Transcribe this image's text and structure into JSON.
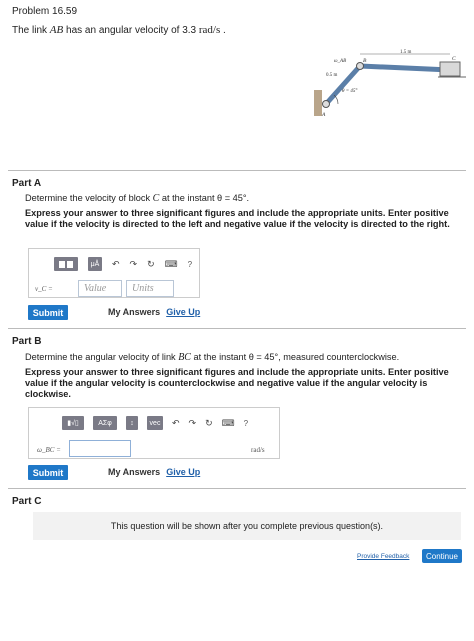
{
  "problem_title": "Problem 16.59",
  "intro": {
    "prefix": "The link ",
    "link": "AB",
    "middle": " has an angular velocity of 3.3 ",
    "unit": "rad/s",
    "suffix": " ."
  },
  "figure": {
    "dim_bc": "1.5 m",
    "dim_ab": "0.5 m",
    "omega_label": "ω_AB",
    "angle_label": "θ = 45°",
    "point_a": "A",
    "point_b": "B",
    "point_c": "C"
  },
  "partA": {
    "heading": "Part A",
    "question_prefix": "Determine the velocity of block ",
    "question_var": "C",
    "question_suffix": " at the instant θ = 45°.",
    "instructions": "Express your answer to three significant figures and include the appropriate units. Enter positive value if the velocity is directed to the left and negative value if the velocity is directed to the right.",
    "toolbar_help": "?",
    "input_label": "v_C =",
    "value_placeholder": "Value",
    "units_placeholder": "Units",
    "submit_label": "Submit",
    "my_answers": "My Answers",
    "give_up": "Give Up"
  },
  "partB": {
    "heading": "Part B",
    "question_prefix": "Determine the angular velocity of link ",
    "question_var": "BC",
    "question_suffix": " at the instant θ = 45°, measured counterclockwise.",
    "instructions": "Express your answer to three significant figures and include the appropriate units. Enter positive value if the angular velocity is counterclockwise and negative value if the angular velocity is clockwise.",
    "toolbar_symbols": "ΑΣφ",
    "toolbar_vec": "vec",
    "toolbar_help": "?",
    "input_label": "ω_BC =",
    "unit": "rad/s",
    "submit_label": "Submit",
    "my_answers": "My Answers",
    "give_up": "Give Up"
  },
  "partC": {
    "heading": "Part C",
    "notice": "This question will be shown after you complete previous question(s)."
  },
  "footer": {
    "feedback": "Provide Feedback",
    "continue": "Continue"
  }
}
